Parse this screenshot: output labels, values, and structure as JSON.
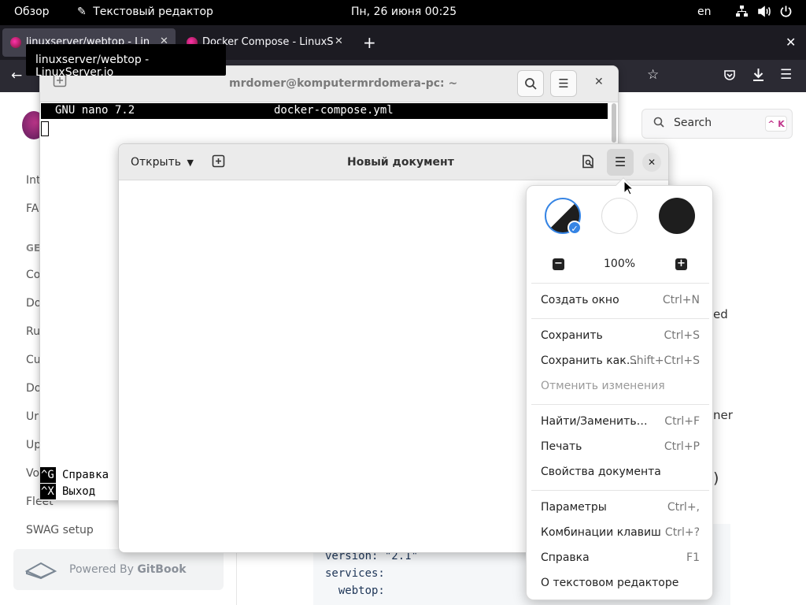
{
  "topbar": {
    "overview": "Обзор",
    "app_name": "Текстовый редактор",
    "clock": "Пн, 26 июня  00:25",
    "lang": "en"
  },
  "browser": {
    "tabs": [
      {
        "label": "linuxserver/webtop - Lin",
        "active": true
      },
      {
        "label": "Docker Compose - LinuxS",
        "active": false
      }
    ],
    "tooltip": "linuxserver/webtop - LinuxServer.io"
  },
  "site": {
    "sidebar_partial": [
      "Int",
      "FA",
      "GE",
      "Co",
      "Do",
      "Ru",
      "Cu",
      "Do",
      "Ur",
      "Up",
      "Vo",
      "Fleet",
      "SWAG setup"
    ],
    "search_label": "Search",
    "search_shortcut": "^ K",
    "powered_by_prefix": "Powered By ",
    "powered_by_brand": "GitBook",
    "right_partials": [
      "ed",
      "ner",
      ")"
    ],
    "code_lines": [
      "version: \"2.1\"",
      "services:",
      "  webtop:"
    ]
  },
  "terminal": {
    "title": "mrdomer@komputermrdomera-pc: ~",
    "nano_version": "GNU nano 7.2",
    "nano_filename": "docker-compose.yml",
    "help_key": "^G",
    "help_label": "Справка",
    "exit_key": "^X",
    "exit_label": "Выход"
  },
  "editor": {
    "open_label": "Открыть",
    "title": "Новый документ"
  },
  "menu": {
    "zoom": "100%",
    "items": [
      {
        "label": "Создать окно",
        "accel": "Ctrl+N"
      },
      {
        "label": "Сохранить",
        "accel": "Ctrl+S"
      },
      {
        "label": "Сохранить как…",
        "accel": "Shift+Ctrl+S"
      },
      {
        "label": "Отменить изменения",
        "accel": ""
      },
      {
        "label": "Найти/Заменить…",
        "accel": "Ctrl+F"
      },
      {
        "label": "Печать",
        "accel": "Ctrl+P"
      },
      {
        "label": "Свойства документа",
        "accel": ""
      },
      {
        "label": "Параметры",
        "accel": "Ctrl+,"
      },
      {
        "label": "Комбинации клавиш",
        "accel": "Ctrl+?"
      },
      {
        "label": "Справка",
        "accel": "F1"
      },
      {
        "label": "О текстовом редакторе",
        "accel": ""
      }
    ]
  },
  "colors": {
    "accent": "#3584e4",
    "topbar": "#000000",
    "browser_tabbar": "#1c1b22",
    "browser_navbar": "#2b2a33"
  }
}
